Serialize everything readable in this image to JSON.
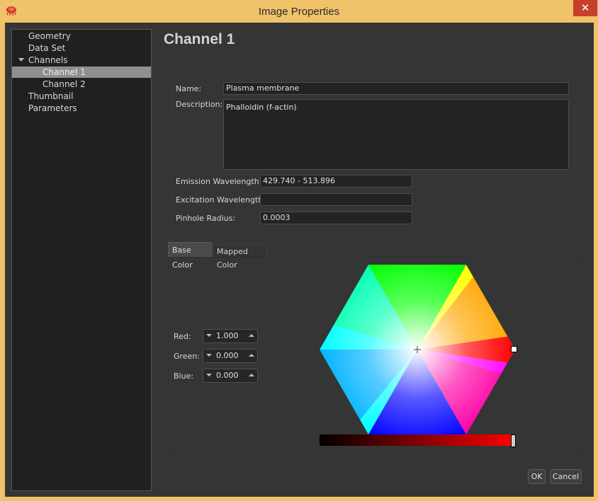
{
  "window": {
    "title": "Image Properties",
    "close_glyph": "✕",
    "app_icon": "jellyfish-app-icon"
  },
  "tree": {
    "items": [
      {
        "label": "Geometry"
      },
      {
        "label": "Data Set"
      },
      {
        "label": "Channels"
      },
      {
        "label": "Channel 1"
      },
      {
        "label": "Channel 2"
      },
      {
        "label": "Thumbnail"
      },
      {
        "label": "Parameters"
      }
    ]
  },
  "page": {
    "heading": "Channel 1"
  },
  "form": {
    "name_label": "Name:",
    "name_value": "Plasma membrane",
    "description_label": "Description:",
    "description_value": "Phalloidin (f-actin)",
    "emission_label": "Emission Wavelength:",
    "emission_value": "429.740 - 513.896",
    "excitation_label": "Excitation Wavelength:",
    "excitation_value": "",
    "pinhole_label": "Pinhole Radius:",
    "pinhole_value": "0.0003"
  },
  "tabs": [
    {
      "label": "Base Color"
    },
    {
      "label": "Mapped Color"
    }
  ],
  "color": {
    "red_label": "Red:",
    "red_value": "1.000",
    "green_label": "Green:",
    "green_value": "0.000",
    "blue_label": "Blue:",
    "blue_value": "0.000"
  },
  "buttons": {
    "ok": "OK",
    "cancel": "Cancel"
  }
}
